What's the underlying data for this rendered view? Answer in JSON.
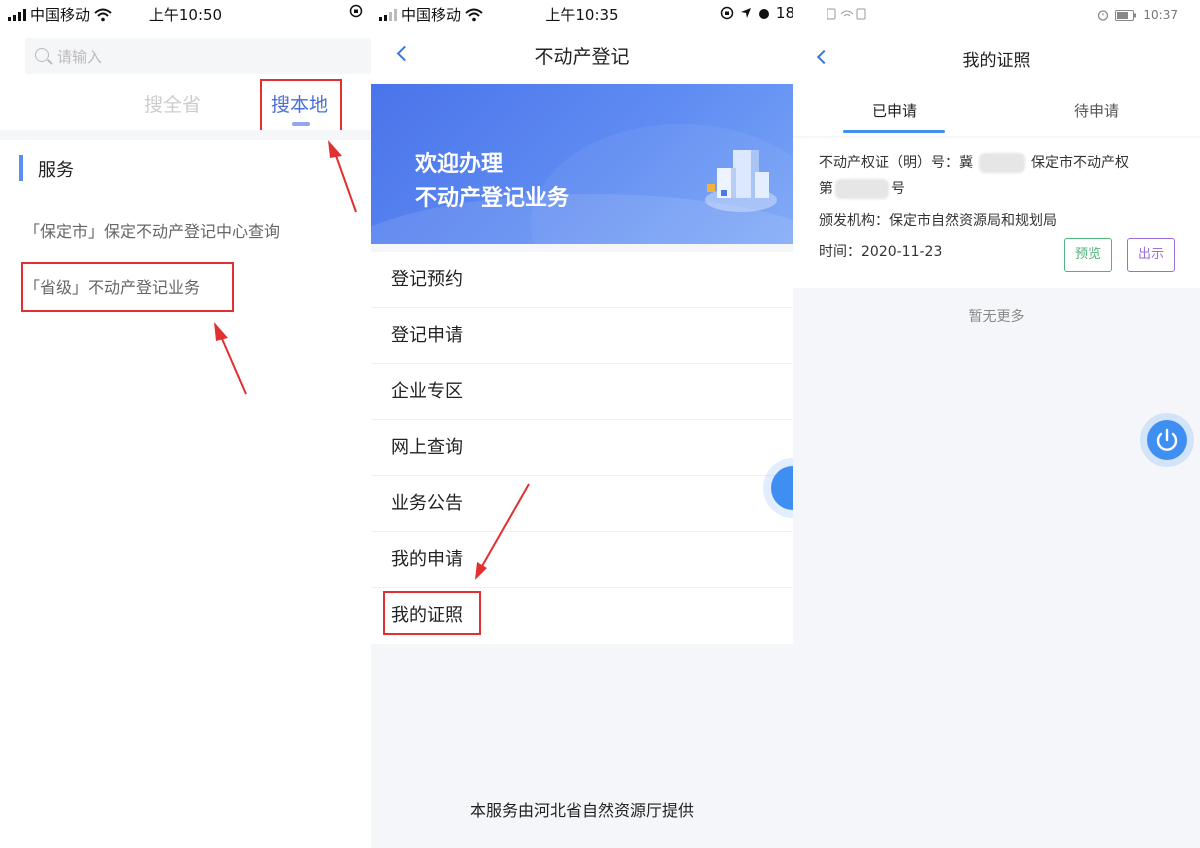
{
  "panel1": {
    "status": {
      "carrier": "中国移动",
      "time": "上午10:50"
    },
    "search": {
      "placeholder": "请输入"
    },
    "tabs": {
      "all": "搜全省",
      "local": "搜本地"
    },
    "section_title": "服务",
    "services": [
      "「保定市」保定不动产登记中心查询",
      "「省级」不动产登记业务"
    ]
  },
  "panel2": {
    "status": {
      "carrier": "中国移动",
      "time": "上午10:35",
      "battery": "18"
    },
    "title": "不动产登记",
    "banner": {
      "line1": "欢迎办理",
      "line2": "不动产登记业务"
    },
    "menu": [
      "登记预约",
      "登记申请",
      "企业专区",
      "网上查询",
      "业务公告",
      "我的申请",
      "我的证照"
    ],
    "footer": "本服务由河北省自然资源厅提供"
  },
  "panel3": {
    "status": {
      "time": "10:37"
    },
    "title": "我的证照",
    "tabs": {
      "applied": "已申请",
      "pending": "待申请"
    },
    "card": {
      "cert_prefix": "不动产权证（明）号：冀",
      "cert_suffix": "保定市不动产权",
      "cert_line2_prefix": "第",
      "cert_line2_suffix": "号",
      "issuer": "颁发机构：保定市自然资源局和规划局",
      "time": "时间：2020-11-23",
      "preview": "预览",
      "show": "出示"
    },
    "no_more": "暂无更多"
  },
  "colors": {
    "accent": "#3f8ef2",
    "highlight": "#e03030"
  }
}
